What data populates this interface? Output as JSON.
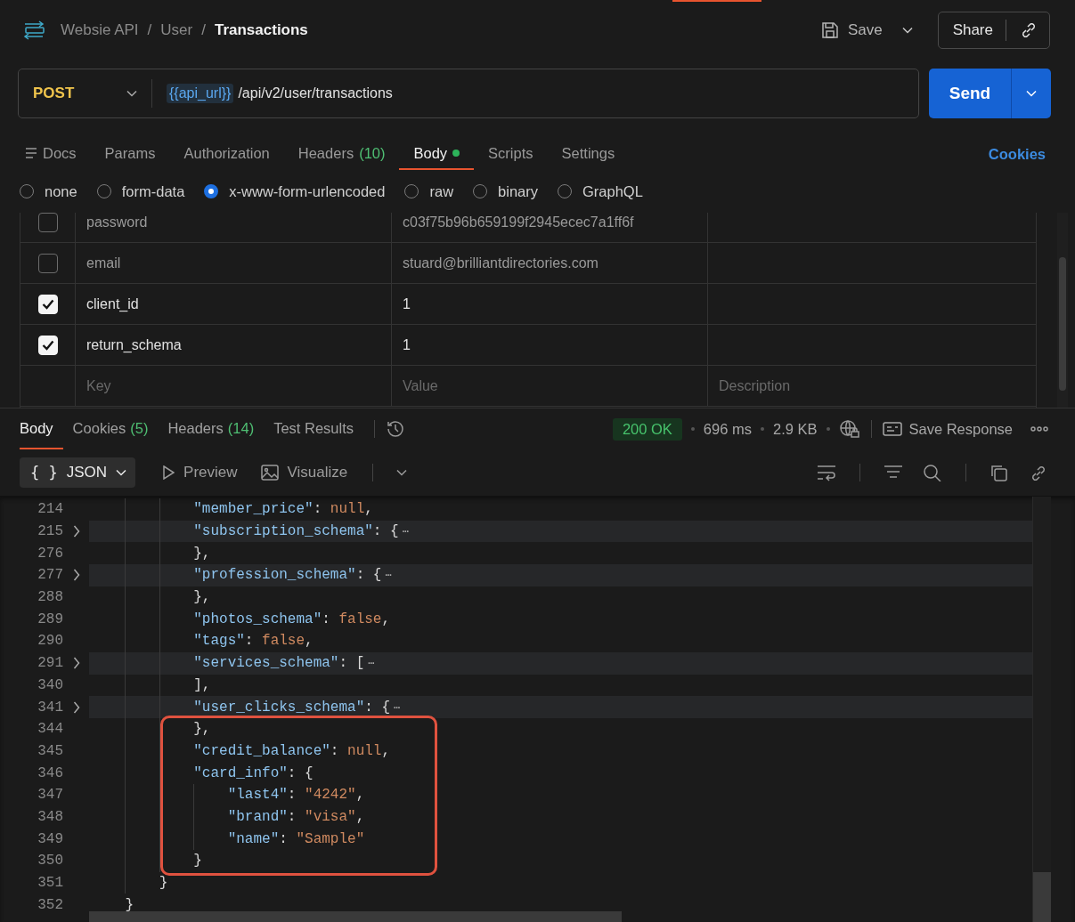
{
  "breadcrumb": [
    "Websie API",
    "User",
    "Transactions"
  ],
  "breadcrumb_separators": [
    "/",
    "/"
  ],
  "header_actions": {
    "save": "Save",
    "share": "Share"
  },
  "request": {
    "method": "POST",
    "url_variable": "{{api_url}}",
    "url_path": "/api/v2/user/transactions",
    "send": "Send"
  },
  "request_tabs": [
    {
      "label": "Docs",
      "kind": "docs",
      "selected": false
    },
    {
      "label": "Params",
      "selected": false
    },
    {
      "label": "Authorization",
      "selected": false
    },
    {
      "label": "Headers",
      "count": "(10)",
      "selected": false
    },
    {
      "label": "Body",
      "dot": true,
      "selected": true
    },
    {
      "label": "Scripts",
      "selected": false
    },
    {
      "label": "Settings",
      "selected": false
    }
  ],
  "cookies_link": "Cookies",
  "body_types": [
    {
      "label": "none",
      "selected": false
    },
    {
      "label": "form-data",
      "selected": false
    },
    {
      "label": "x-www-form-urlencoded",
      "selected": true
    },
    {
      "label": "raw",
      "selected": false
    },
    {
      "label": "binary",
      "selected": false
    },
    {
      "label": "GraphQL",
      "selected": false
    }
  ],
  "params": {
    "rows": [
      {
        "checked": false,
        "key": "password",
        "value": "c03f75b96b659199f2945ecec7a1ff6f"
      },
      {
        "checked": false,
        "key": "email",
        "value": "stuard@brilliantdirectories.com"
      },
      {
        "checked": true,
        "key": "client_id",
        "value": "1"
      },
      {
        "checked": true,
        "key": "return_schema",
        "value": "1"
      }
    ],
    "new_row": {
      "key_placeholder": "Key",
      "value_placeholder": "Value",
      "description_placeholder": "Description"
    }
  },
  "response_tabs": [
    {
      "label": "Body",
      "selected": true
    },
    {
      "label": "Cookies",
      "count": "(5)",
      "selected": false
    },
    {
      "label": "Headers",
      "count": "(14)",
      "selected": false
    },
    {
      "label": "Test Results",
      "selected": false
    }
  ],
  "response_status": {
    "status": "200 OK",
    "time": "696 ms",
    "size": "2.9 KB",
    "save_response": "Save Response"
  },
  "viewer": {
    "format_icon": "{ }",
    "format": "JSON",
    "preview": "Preview",
    "visualize": "Visualize"
  },
  "code": {
    "lines_before": [
      {
        "number": "214",
        "foldable": false,
        "tokens": [
          {
            "kind": "key",
            "text": "            \"member_price\""
          },
          {
            "kind": "punct",
            "text": ": "
          },
          {
            "kind": "literal",
            "text": "null"
          },
          {
            "kind": "punct",
            "text": ","
          }
        ]
      },
      {
        "number": "215",
        "foldable": true,
        "tokens": [
          {
            "kind": "key",
            "text": "            \"subscription_schema\""
          },
          {
            "kind": "punct",
            "text": ": {"
          },
          {
            "kind": "ellipsis",
            "text": "⋯"
          }
        ]
      },
      {
        "number": "276",
        "foldable": false,
        "tokens": [
          {
            "kind": "punct",
            "text": "            },"
          }
        ]
      },
      {
        "number": "277",
        "foldable": true,
        "tokens": [
          {
            "kind": "key",
            "text": "            \"profession_schema\""
          },
          {
            "kind": "punct",
            "text": ": {"
          },
          {
            "kind": "ellipsis",
            "text": "⋯"
          }
        ]
      },
      {
        "number": "288",
        "foldable": false,
        "tokens": [
          {
            "kind": "punct",
            "text": "            },"
          }
        ]
      },
      {
        "number": "289",
        "foldable": false,
        "tokens": [
          {
            "kind": "key",
            "text": "            \"photos_schema\""
          },
          {
            "kind": "punct",
            "text": ": "
          },
          {
            "kind": "literal",
            "text": "false"
          },
          {
            "kind": "punct",
            "text": ","
          }
        ]
      },
      {
        "number": "290",
        "foldable": false,
        "tokens": [
          {
            "kind": "key",
            "text": "            \"tags\""
          },
          {
            "kind": "punct",
            "text": ": "
          },
          {
            "kind": "literal",
            "text": "false"
          },
          {
            "kind": "punct",
            "text": ","
          }
        ]
      },
      {
        "number": "291",
        "foldable": true,
        "tokens": [
          {
            "kind": "key",
            "text": "            \"services_schema\""
          },
          {
            "kind": "punct",
            "text": ": ["
          },
          {
            "kind": "ellipsis",
            "text": "⋯"
          }
        ]
      },
      {
        "number": "340",
        "foldable": false,
        "tokens": [
          {
            "kind": "punct",
            "text": "            ],"
          }
        ]
      },
      {
        "number": "341",
        "foldable": true,
        "tokens": [
          {
            "kind": "key",
            "text": "            \"user_clicks_schema\""
          },
          {
            "kind": "punct",
            "text": ": {"
          },
          {
            "kind": "ellipsis",
            "text": "⋯"
          }
        ]
      }
    ],
    "highlighted_lines": [
      {
        "number": "344",
        "foldable": false,
        "tokens": [
          {
            "kind": "punct",
            "text": "            },"
          }
        ]
      },
      {
        "number": "345",
        "foldable": false,
        "tokens": [
          {
            "kind": "key",
            "text": "            \"credit_balance\""
          },
          {
            "kind": "punct",
            "text": ": "
          },
          {
            "kind": "literal",
            "text": "null"
          },
          {
            "kind": "punct",
            "text": ","
          }
        ]
      },
      {
        "number": "346",
        "foldable": false,
        "tokens": [
          {
            "kind": "key",
            "text": "            \"card_info\""
          },
          {
            "kind": "punct",
            "text": ": {"
          }
        ]
      },
      {
        "number": "347",
        "foldable": false,
        "tokens": [
          {
            "kind": "key",
            "text": "                \"last4\""
          },
          {
            "kind": "punct",
            "text": ": "
          },
          {
            "kind": "string",
            "text": "\"4242\""
          },
          {
            "kind": "punct",
            "text": ","
          }
        ]
      },
      {
        "number": "348",
        "foldable": false,
        "tokens": [
          {
            "kind": "key",
            "text": "                \"brand\""
          },
          {
            "kind": "punct",
            "text": ": "
          },
          {
            "kind": "string",
            "text": "\"visa\""
          },
          {
            "kind": "punct",
            "text": ","
          }
        ]
      },
      {
        "number": "349",
        "foldable": false,
        "tokens": [
          {
            "kind": "key",
            "text": "                \"name\""
          },
          {
            "kind": "punct",
            "text": ": "
          },
          {
            "kind": "string",
            "text": "\"Sample\""
          }
        ]
      },
      {
        "number": "350",
        "foldable": false,
        "tokens": [
          {
            "kind": "punct",
            "text": "            }"
          }
        ]
      }
    ],
    "lines_after": [
      {
        "number": "351",
        "foldable": false,
        "tokens": [
          {
            "kind": "punct",
            "text": "        }"
          }
        ]
      },
      {
        "number": "352",
        "foldable": false,
        "tokens": [
          {
            "kind": "punct",
            "text": "    }"
          }
        ]
      }
    ]
  }
}
